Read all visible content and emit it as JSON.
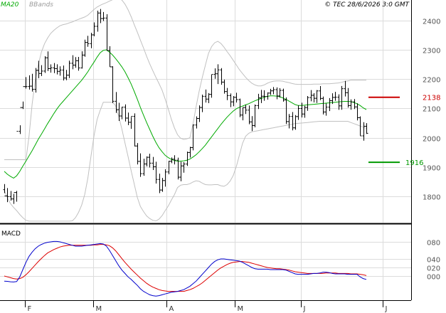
{
  "header": {
    "legend_ma20": "MA20",
    "legend_bbands": "BBands",
    "copyright": "© TEC 28/6/2026 3:0 GMT"
  },
  "macd_label": "MACD",
  "colors": {
    "bars": "#000000",
    "ma20": "#00aa00",
    "bbands": "#c0c0c0",
    "macd": "#0000cc",
    "signal": "#dd0000",
    "grid": "#dcdcdc",
    "axis": "#000000",
    "ref_upper": "#cc0000",
    "ref_lower": "#009900",
    "legend_ma20": "#00aa00",
    "legend_bbands": "#999999"
  },
  "chart_data": [
    {
      "type": "ohlc",
      "name": "price",
      "ylim": [
        1710,
        2470
      ],
      "yticks": [
        1800,
        1900,
        2000,
        2100,
        2200,
        2300,
        2400
      ],
      "x_categories": [
        "F",
        "M",
        "A",
        "M",
        "J",
        "J"
      ],
      "grid": true,
      "legend": "top-left",
      "bar_count": 118,
      "bars_open": [
        1822.6,
        1801.3,
        1798.7,
        1790.9,
        1812.8,
        2021.8,
        2103.0,
        2174.5,
        2174.7,
        2176.0,
        2165.1,
        2229.8,
        2219.3,
        2227.4,
        2272.7,
        2235.8,
        2238.6,
        2235.9,
        2226.6,
        2231.0,
        2203.6,
        2213.4,
        2254.1,
        2247.8,
        2262.6,
        2238.1,
        2282.1,
        2325.2,
        2321.1,
        2351.0,
        2380.2,
        2425.6,
        2406.7,
        2408.4,
        2297.7,
        2241.8,
        2124.3,
        2095.5,
        2074.1,
        2104.3,
        2066.9,
        2052.6,
        2072.9,
        1971.7,
        1919.1,
        1877.3,
        1910.3,
        1933.2,
        1913.1,
        1901.0,
        1857.6,
        1821.4,
        1853.7,
        1883.0,
        1919.7,
        1926.6,
        1923.2,
        1865.3,
        1903.7,
        1910.1,
        1949.5,
        1966.2,
        2043.3,
        2065.7,
        2103.2,
        2141.3,
        2131.8,
        2147.9,
        2216.0,
        2218.1,
        2231.5,
        2189.8,
        2157.5,
        2143.5,
        2122.3,
        2137.8,
        2130.0,
        2077.3,
        2103.2,
        2094.2,
        2053.9,
        2041.7,
        2109.6,
        2135.8,
        2141.6,
        2140.8,
        2152.3,
        2159.9,
        2164.0,
        2142.4,
        2161.5,
        2128.9,
        2055.0,
        2072.5,
        2033.6,
        2072.2,
        2099.7,
        2080.9,
        2103.3,
        2136.9,
        2144.8,
        2134.6,
        2159.7,
        2134.1,
        2087.8,
        2104.4,
        2126.3,
        2137.5,
        2138.3,
        2108.6,
        2167.3,
        2153.6,
        2109.7,
        2122.3,
        2105.1,
        2068.3,
        2006.2,
        2039.1
      ],
      "bars_high": [
        1841.6,
        1828.0,
        1818.0,
        1808.4,
        1818.4,
        2042.4,
        2123.4,
        2206.8,
        2213.0,
        2218.0,
        2237.8,
        2262.3,
        2247.4,
        2278.2,
        2294.5,
        2250.3,
        2254.8,
        2250.7,
        2243.5,
        2246.3,
        2231.4,
        2263.1,
        2281.5,
        2275.1,
        2275.9,
        2295.0,
        2334.7,
        2347.6,
        2358.0,
        2393.5,
        2433.6,
        2439.2,
        2429.1,
        2421.5,
        2312.2,
        2244.0,
        2155.8,
        2119.0,
        2105.5,
        2113.7,
        2085.7,
        2070.8,
        2083.1,
        1981.6,
        1946.4,
        1928.2,
        1936.2,
        1945.1,
        1934.2,
        1918.0,
        1877.2,
        1862.6,
        1892.3,
        1921.3,
        1932.5,
        1940.1,
        1931.8,
        1918.0,
        1916.3,
        1952.4,
        1968.9,
        2045.5,
        2072.8,
        2110.2,
        2147.2,
        2164.5,
        2152.3,
        2215.4,
        2236.7,
        2250.5,
        2237.6,
        2198.5,
        2169.7,
        2150.9,
        2142.3,
        2153.3,
        2133.4,
        2103.5,
        2112.2,
        2109.8,
        2073.7,
        2113.5,
        2149.7,
        2163.0,
        2162.0,
        2154.8,
        2166.8,
        2173.0,
        2171.6,
        2169.2,
        2167.5,
        2137.3,
        2080.8,
        2087.6,
        2077.4,
        2110.2,
        2119.5,
        2108.8,
        2142.2,
        2162.5,
        2151.8,
        2162.5,
        2176.3,
        2140.4,
        2116.9,
        2135.1,
        2151.5,
        2156.4,
        2148.0,
        2176.5,
        2193.9,
        2169.6,
        2130.8,
        2131.9,
        2117.2,
        2072.6,
        2052.9,
        2049.6
      ],
      "bars_low": [
        1810.7,
        1780.1,
        1785.3,
        1774.0,
        1781.5,
        2012.5,
        2098.0,
        2167.6,
        2164.5,
        2157.3,
        2154.1,
        2203.1,
        2210.5,
        2221.0,
        2227.4,
        2221.9,
        2220.6,
        2216.0,
        2211.7,
        2195.2,
        2196.2,
        2203.6,
        2233.6,
        2238.8,
        2228.7,
        2235.9,
        2276.3,
        2310.3,
        2305.5,
        2346.1,
        2361.8,
        2391.0,
        2398.5,
        2296.4,
        2241.8,
        2118.1,
        2084.6,
        2057.2,
        2063.0,
        2055.4,
        2043.0,
        2030.2,
        1970.1,
        1908.7,
        1866.4,
        1869.9,
        1902.1,
        1898.6,
        1889.7,
        1843.5,
        1810.9,
        1815.4,
        1833.0,
        1875.1,
        1913.0,
        1908.7,
        1857.5,
        1851.4,
        1880.7,
        1903.6,
        1932.3,
        1956.8,
        2031.3,
        2053.6,
        2087.3,
        2120.0,
        2117.8,
        2136.3,
        2201.1,
        2183.2,
        2180.6,
        2150.5,
        2128.1,
        2104.4,
        2107.3,
        2119.9,
        2070.3,
        2059.4,
        2080.9,
        2046.1,
        2022.6,
        2035.5,
        2098.0,
        2118.3,
        2126.0,
        2130.0,
        2145.8,
        2148.2,
        2131.4,
        2136.9,
        2123.0,
        2046.8,
        2031.8,
        2024.9,
        2027.2,
        2060.9,
        2069.1,
        2068.1,
        2091.8,
        2124.4,
        2120.2,
        2118.4,
        2128.1,
        2079.5,
        2075.1,
        2090.8,
        2115.2,
        2126.0,
        2095.3,
        2095.4,
        2140.8,
        2102.6,
        2095.5,
        2097.9,
        2058.9,
        2007.2,
        1989.7,
        2013.0
      ],
      "bars_close": [
        1801.3,
        1798.7,
        1790.9,
        1812.8,
        2021.8,
        2103.0,
        2174.5,
        2174.7,
        2176.0,
        2165.1,
        2229.8,
        2219.3,
        2227.4,
        2272.7,
        2235.8,
        2238.6,
        2235.9,
        2226.6,
        2231.0,
        2203.6,
        2213.4,
        2254.1,
        2247.8,
        2262.6,
        2238.1,
        2282.1,
        2325.2,
        2321.1,
        2351.0,
        2380.2,
        2425.6,
        2406.7,
        2408.4,
        2297.7,
        2241.8,
        2124.3,
        2095.5,
        2074.1,
        2104.3,
        2066.9,
        2052.6,
        2072.9,
        1971.7,
        1919.1,
        1877.3,
        1910.3,
        1933.2,
        1913.1,
        1901.0,
        1857.6,
        1821.4,
        1853.7,
        1883.0,
        1919.7,
        1926.6,
        1923.2,
        1865.3,
        1903.7,
        1910.1,
        1949.5,
        1966.2,
        2043.3,
        2065.7,
        2103.2,
        2141.3,
        2131.8,
        2147.9,
        2216.0,
        2218.1,
        2231.5,
        2189.8,
        2157.5,
        2143.5,
        2122.3,
        2137.8,
        2130.0,
        2077.3,
        2103.2,
        2094.2,
        2053.9,
        2041.7,
        2109.6,
        2135.8,
        2141.6,
        2140.8,
        2152.3,
        2159.9,
        2164.0,
        2142.4,
        2161.5,
        2128.9,
        2055.0,
        2072.5,
        2033.6,
        2072.2,
        2099.7,
        2080.9,
        2103.3,
        2136.9,
        2144.8,
        2134.6,
        2159.7,
        2134.1,
        2087.8,
        2104.4,
        2126.3,
        2137.5,
        2138.3,
        2108.6,
        2167.3,
        2153.6,
        2109.7,
        2122.3,
        2105.1,
        2068.3,
        2006.2,
        2039.1,
        2015.0
      ],
      "ma20": [
        1885,
        1875,
        1868,
        1862,
        1870,
        1885,
        1903,
        1920,
        1938,
        1956,
        1975,
        1995,
        2012,
        2030,
        2048,
        2065,
        2082,
        2098,
        2112,
        2124,
        2136,
        2148,
        2160,
        2172,
        2184,
        2196,
        2210,
        2225,
        2242,
        2258,
        2275,
        2290,
        2298,
        2300,
        2292,
        2282,
        2270,
        2256,
        2242,
        2225,
        2205,
        2183,
        2158,
        2131,
        2103,
        2077,
        2052,
        2028,
        2005,
        1984,
        1966,
        1952,
        1940,
        1932,
        1926,
        1922,
        1920,
        1920,
        1921,
        1923,
        1927,
        1934,
        1942,
        1952,
        1963,
        1975,
        1989,
        2003,
        2017,
        2031,
        2045,
        2058,
        2070,
        2081,
        2091,
        2099,
        2104,
        2108,
        2112,
        2116,
        2121,
        2126,
        2130,
        2134,
        2138,
        2141,
        2143,
        2143,
        2142,
        2140,
        2136,
        2131,
        2125,
        2119,
        2113,
        2110,
        2110,
        2111,
        2112,
        2113,
        2114,
        2115,
        2116,
        2117,
        2118,
        2119,
        2120,
        2121,
        2122,
        2123,
        2124,
        2124,
        2123,
        2120,
        2116,
        2110,
        2102,
        2096
      ],
      "bb_upper": [
        1925,
        1925,
        1925,
        1925,
        1925,
        1925,
        1925,
        1925,
        2005,
        2115,
        2195,
        2250,
        2292,
        2321,
        2340,
        2356,
        2366,
        2375,
        2382,
        2386,
        2388,
        2392,
        2395,
        2400,
        2404,
        2408,
        2412,
        2418,
        2428,
        2438,
        2446,
        2452,
        2457,
        2461,
        2466,
        2471,
        2474,
        2474,
        2470,
        2456,
        2437,
        2413,
        2386,
        2360,
        2333,
        2306,
        2278,
        2252,
        2229,
        2206,
        2185,
        2162,
        2132,
        2098,
        2063,
        2033,
        2010,
        1998,
        1994,
        1996,
        2000,
        2048,
        2106,
        2160,
        2206,
        2248,
        2288,
        2311,
        2324,
        2329,
        2322,
        2309,
        2294,
        2280,
        2264,
        2248,
        2232,
        2219,
        2206,
        2195,
        2186,
        2180,
        2177,
        2177,
        2180,
        2186,
        2190,
        2193,
        2194,
        2194,
        2193,
        2190,
        2188,
        2185,
        2183,
        2182,
        2182,
        2182,
        2182,
        2182,
        2183,
        2183,
        2183,
        2184,
        2184,
        2184,
        2185,
        2186,
        2187,
        2189,
        2192,
        2194,
        2196,
        2196,
        2196,
        2196,
        2196,
        2196
      ],
      "bb_lower": [
        1820,
        1795,
        1775,
        1762,
        1751,
        1738,
        1727,
        1718,
        1715,
        1715,
        1715,
        1715,
        1715,
        1715,
        1715,
        1715,
        1715,
        1715,
        1715,
        1715,
        1715,
        1715,
        1716,
        1727,
        1745,
        1770,
        1806,
        1862,
        1935,
        2007,
        2062,
        2094,
        2121,
        2121,
        2121,
        2121,
        2109,
        2072,
        2030,
        1982,
        1936,
        1887,
        1842,
        1796,
        1765,
        1748,
        1733,
        1724,
        1718,
        1716,
        1722,
        1734,
        1751,
        1767,
        1787,
        1806,
        1830,
        1838,
        1840,
        1840,
        1843,
        1849,
        1853,
        1851,
        1845,
        1840,
        1839,
        1839,
        1840,
        1840,
        1836,
        1834,
        1840,
        1852,
        1871,
        1902,
        1941,
        1981,
        2005,
        2015,
        2020,
        2022,
        2024,
        2026,
        2028,
        2030,
        2032,
        2034,
        2036,
        2038,
        2040,
        2042,
        2044,
        2046,
        2048,
        2049,
        2050,
        2051,
        2052,
        2053,
        2054,
        2055,
        2056,
        2056,
        2056,
        2056,
        2056,
        2056,
        2056,
        2056,
        2056,
        2056,
        2052,
        2048,
        2044,
        2040,
        2036,
        2032
      ],
      "ref_upper": 2138,
      "ref_lower": 1916
    },
    {
      "type": "line",
      "name": "macd",
      "ylim": [
        -55,
        120
      ],
      "yticks": [
        0,
        20,
        40,
        80
      ],
      "ytick_labels": [
        "000",
        "020",
        "040",
        "080"
      ],
      "legend": "top-left",
      "macd_line": [
        -12.0,
        -12.5,
        -13.5,
        -14.0,
        -13.0,
        -2.0,
        15.0,
        32.0,
        46.0,
        56.0,
        64.0,
        70.0,
        74.0,
        77.0,
        79.0,
        80.0,
        81.0,
        81.0,
        80.0,
        78.0,
        76.0,
        74.0,
        72.0,
        70.0,
        70.0,
        70.0,
        71.0,
        72.0,
        73.0,
        74.0,
        75.0,
        76.0,
        75.0,
        70.0,
        60.0,
        48.0,
        36.0,
        24.0,
        14.0,
        6.0,
        -2.0,
        -8.0,
        -15.0,
        -22.0,
        -30.0,
        -36.0,
        -40.0,
        -44.0,
        -46.0,
        -47.0,
        -46.0,
        -44.0,
        -42.0,
        -40.0,
        -38.0,
        -37.0,
        -36.0,
        -34.0,
        -32.0,
        -28.0,
        -24.0,
        -18.0,
        -12.0,
        -4.0,
        4.0,
        12.0,
        20.0,
        28.0,
        34.0,
        38.0,
        40.0,
        40.0,
        39.0,
        38.0,
        37.0,
        36.0,
        35.0,
        32.0,
        28.0,
        24.0,
        20.0,
        17.0,
        16.0,
        16.0,
        16.0,
        16.0,
        15.0,
        15.0,
        15.0,
        15.0,
        15.0,
        14.0,
        11.0,
        8.0,
        5.0,
        4.0,
        4.0,
        4.0,
        4.0,
        5.0,
        6.0,
        6.0,
        7.0,
        9.0,
        9.0,
        8.0,
        6.0,
        5.0,
        5.0,
        5.0,
        5.0,
        4.0,
        4.0,
        4.0,
        4.0,
        -2.0,
        -6.0,
        -8.0
      ],
      "signal_line": [
        0.0,
        -2.0,
        -4.0,
        -6.0,
        -7.0,
        -6.0,
        -3.0,
        3.0,
        10.0,
        18.0,
        26.0,
        34.0,
        41.0,
        48.0,
        54.0,
        58.0,
        62.0,
        65.0,
        68.0,
        70.0,
        71.0,
        72.0,
        72.0,
        72.0,
        72.0,
        72.0,
        72.0,
        72.0,
        72.0,
        73.0,
        73.0,
        74.0,
        74.0,
        73.0,
        71.0,
        66.0,
        59.0,
        50.0,
        41.0,
        32.0,
        24.0,
        16.0,
        9.0,
        2.0,
        -5.0,
        -11.0,
        -17.0,
        -22.0,
        -26.0,
        -29.0,
        -32.0,
        -34.0,
        -35.0,
        -36.0,
        -36.0,
        -36.0,
        -36.0,
        -36.0,
        -36.0,
        -34.0,
        -32.0,
        -29.0,
        -25.0,
        -21.0,
        -16.0,
        -10.0,
        -4.0,
        2.0,
        8.0,
        14.0,
        19.0,
        23.0,
        27.0,
        30.0,
        32.0,
        33.0,
        34.0,
        34.0,
        33.0,
        32.0,
        30.0,
        28.0,
        26.0,
        24.0,
        22.0,
        20.0,
        19.0,
        18.0,
        17.0,
        17.0,
        16.0,
        15.0,
        14.0,
        12.0,
        10.0,
        9.0,
        8.0,
        7.0,
        6.0,
        6.0,
        6.0,
        6.0,
        6.0,
        6.0,
        7.0,
        7.0,
        7.0,
        7.0,
        6.0,
        6.0,
        6.0,
        6.0,
        5.0,
        5.0,
        5.0,
        4.0,
        3.0,
        1.0
      ]
    }
  ]
}
